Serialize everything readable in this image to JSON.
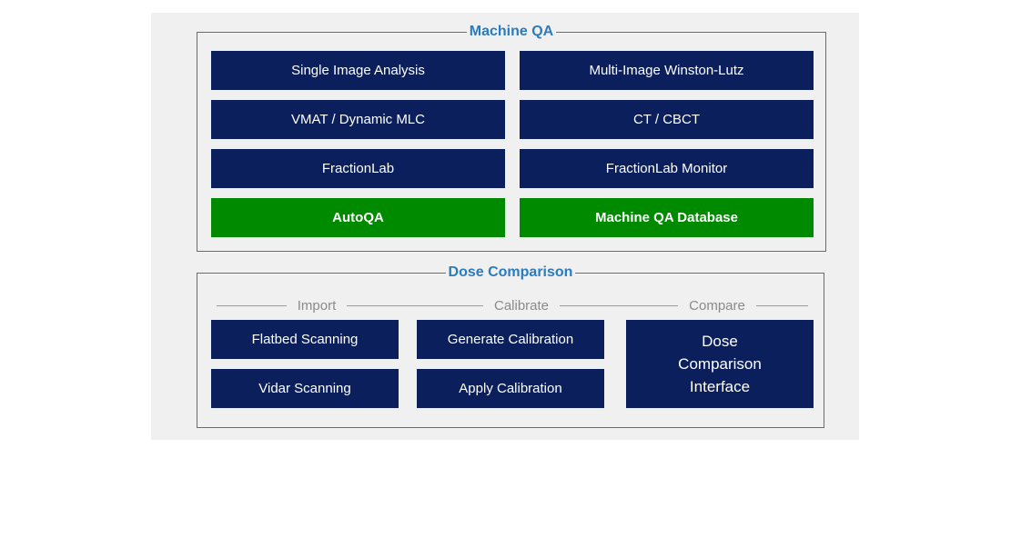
{
  "machine_qa": {
    "title": "Machine QA",
    "buttons": [
      "Single Image Analysis",
      "Multi-Image Winston-Lutz",
      "VMAT / Dynamic MLC",
      "CT / CBCT",
      "FractionLab",
      "FractionLab Monitor",
      "AutoQA",
      "Machine QA Database"
    ]
  },
  "dose_comparison": {
    "title": "Dose Comparison",
    "steps": [
      "Import",
      "Calibrate",
      "Compare"
    ],
    "import_buttons": [
      "Flatbed Scanning",
      "Vidar Scanning"
    ],
    "calibrate_buttons": [
      "Generate Calibration",
      "Apply Calibration"
    ],
    "compare_lines": [
      "Dose",
      "Comparison",
      "Interface"
    ]
  },
  "colors": {
    "navy_button": "#0b1f5c",
    "green_button": "#008a00",
    "title_blue": "#2b7bbf",
    "panel_bg": "#f0f0f0"
  }
}
